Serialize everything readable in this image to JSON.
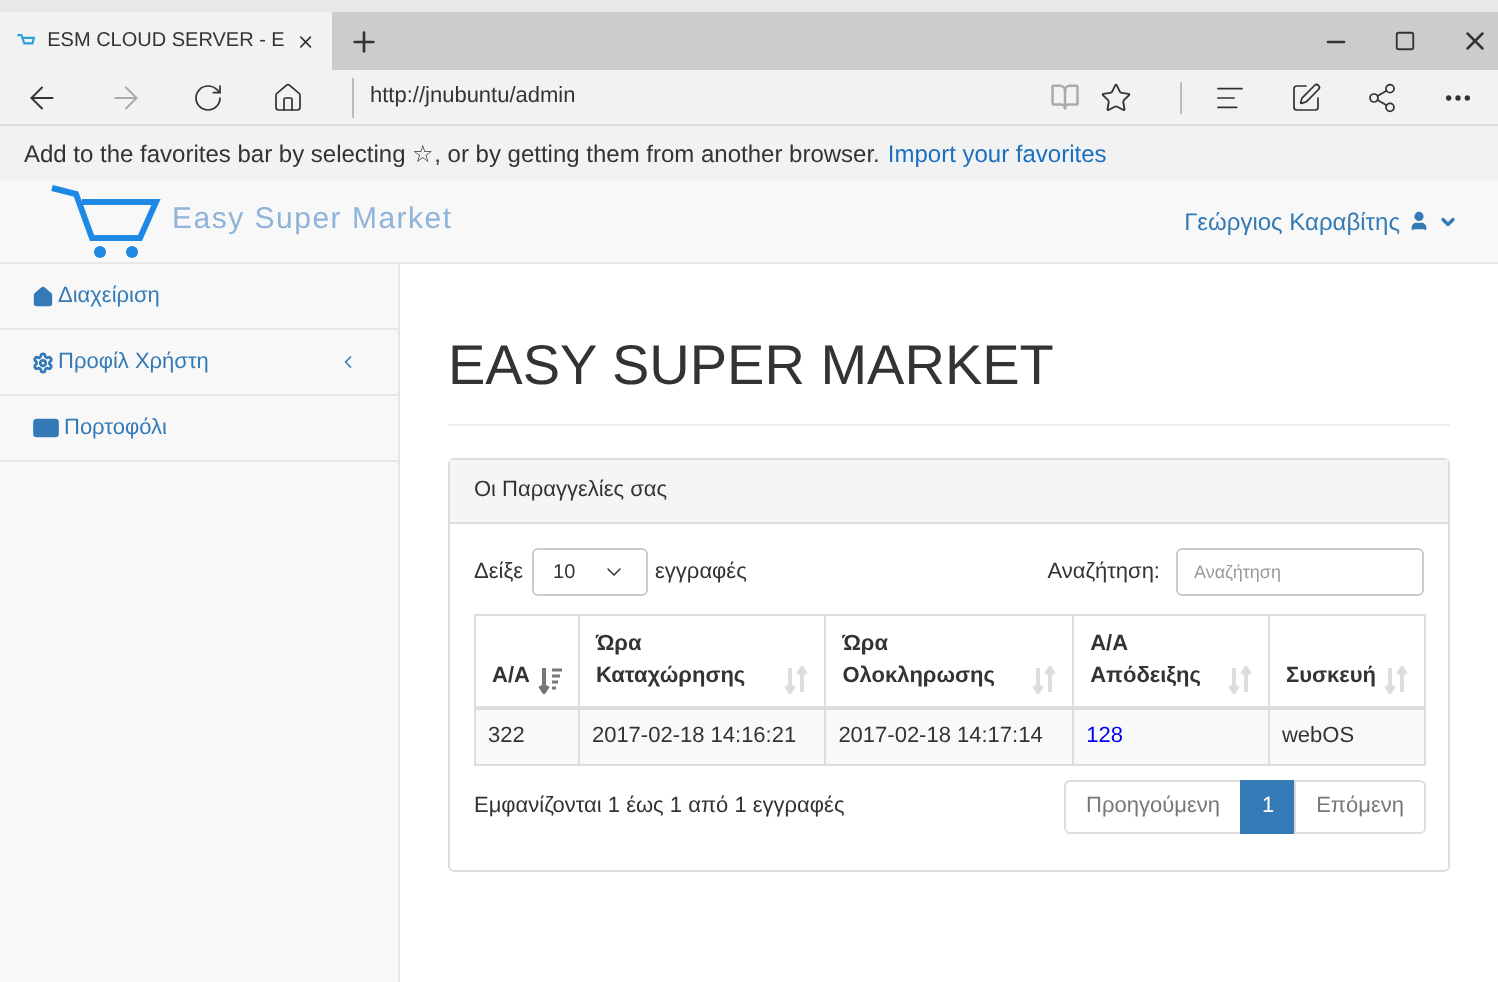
{
  "browser": {
    "tab_title": "ESM CLOUD SERVER - E",
    "url": "http://jnubuntu/admin",
    "favorites_prompt": "Add to the favorites bar by selecting ☆, or by getting them from another browser.",
    "favorites_link": "Import your favorites"
  },
  "header": {
    "logo_text": "Easy Super Market",
    "user": "Γεώργιος Καραβίτης"
  },
  "sidebar": {
    "items": [
      {
        "label": "Διαχείριση",
        "has_submenu": false
      },
      {
        "label": "Προφίλ Χρήστη",
        "has_submenu": true
      },
      {
        "label": "Πορτοφόλι",
        "has_submenu": false
      }
    ]
  },
  "page_title": "EASY SUPER MARKET",
  "panel": {
    "title": "Οι Παραγγελίες σας",
    "show_label": "Δείξε",
    "page_size": "10",
    "entries_label": "εγγραφές",
    "search_label": "Αναζήτηση:",
    "search_placeholder": "Αναζήτηση",
    "table": {
      "columns": [
        {
          "title": "A/A",
          "sorted": true
        },
        {
          "title": "Ώρα Καταχώρησης",
          "sorted": false
        },
        {
          "title": "Ώρα Ολοκληρωσης",
          "sorted": false
        },
        {
          "title": "A/A Απόδειξης",
          "sorted": false
        },
        {
          "title": "Συσκευή",
          "sorted": false
        }
      ],
      "rows": [
        {
          "cells": [
            {
              "text": "322",
              "kind": "text"
            },
            {
              "text": "2017-02-18 14:16:21",
              "kind": "text"
            },
            {
              "text": "2017-02-18 14:17:14",
              "kind": "text"
            },
            {
              "text": "128",
              "kind": "link"
            },
            {
              "text": "webOS",
              "kind": "text"
            }
          ]
        }
      ]
    },
    "info": "Εμφανίζονται 1 έως 1 από 1 εγγραφές",
    "pagination": [
      {
        "label": "Προηγούμενη",
        "selected": false
      },
      {
        "label": "1",
        "selected": true
      },
      {
        "label": "Επόμενη",
        "selected": false
      }
    ]
  }
}
